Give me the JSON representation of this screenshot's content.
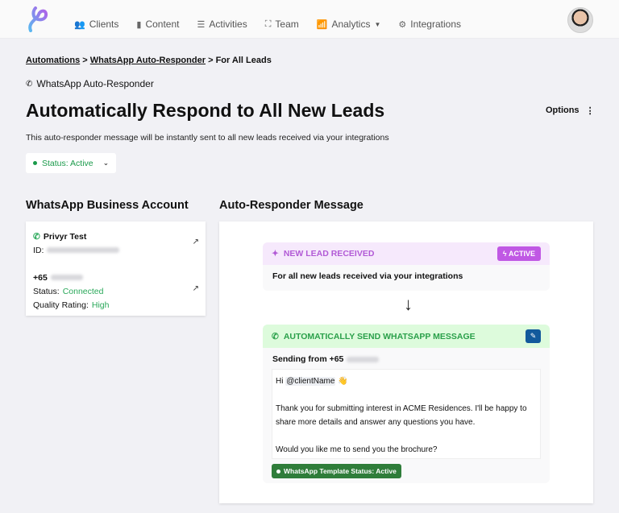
{
  "nav": {
    "items": [
      {
        "label": "Clients",
        "icon": "users-icon"
      },
      {
        "label": "Content",
        "icon": "file-icon"
      },
      {
        "label": "Activities",
        "icon": "list-icon"
      },
      {
        "label": "Team",
        "icon": "sitemap-icon"
      },
      {
        "label": "Analytics",
        "icon": "chart-icon"
      },
      {
        "label": "Integrations",
        "icon": "cogs-icon"
      }
    ]
  },
  "breadcrumb": {
    "items": [
      "Automations",
      "WhatsApp Auto-Responder"
    ],
    "current": "For All Leads",
    "sep": ">"
  },
  "subtitle": "WhatsApp Auto-Responder",
  "title": "Automatically Respond to All New Leads",
  "options_label": "Options",
  "description": "This auto-responder message will be instantly sent to all new leads received via your integrations",
  "status": "Status: Active",
  "account": {
    "heading": "WhatsApp Business Account",
    "name": "Privyr Test",
    "id_label": "ID:",
    "phone_prefix": "+65",
    "status_label": "Status:",
    "status_value": "Connected",
    "quality_label": "Quality Rating:",
    "quality_value": "High"
  },
  "message": {
    "heading": "Auto-Responder Message",
    "trigger": {
      "title": "NEW LEAD RECEIVED",
      "badge": "ACTIVE",
      "body": "For all new leads received via your integrations"
    },
    "action": {
      "title": "AUTOMATICALLY SEND WHATSAPP MESSAGE",
      "sending_label": "Sending from +65",
      "greeting": "Hi",
      "tag": "@clientName",
      "emoji": "👋",
      "line1": "Thank you for submitting interest in ACME Residences. I'll be happy to share more details and answer any questions you have.",
      "line2": "Would you like me to send you the brochure?",
      "template_status": "WhatsApp Template Status: Active"
    }
  },
  "colors": {
    "accent_green": "#2aa85a",
    "trigger_purple": "#c058e4",
    "edit_blue": "#125a9c"
  }
}
